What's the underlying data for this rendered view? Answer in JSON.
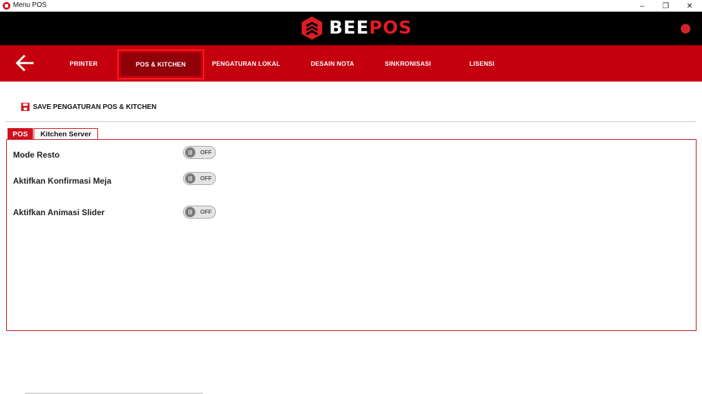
{
  "window": {
    "title": "Menu POS",
    "controls": [
      "–",
      "❐",
      "✕"
    ]
  },
  "header": {
    "brand_white": "BEE",
    "brand_red": "POS",
    "status_color": "#d0232a"
  },
  "nav": {
    "items": [
      {
        "label": "PRINTER"
      },
      {
        "label": "POS & KITCHEN"
      },
      {
        "label": "PENGATURAN LOKAL"
      },
      {
        "label": "DESAIN NOTA"
      },
      {
        "label": "SINKRONISASI"
      },
      {
        "label": "LISENSI"
      }
    ],
    "active_index": 1
  },
  "save": {
    "label": "SAVE PENGATURAN POS & KITCHEN"
  },
  "tabs": [
    {
      "label": "POS",
      "active": true
    },
    {
      "label": "Kitchen Server",
      "active": false
    }
  ],
  "settings": [
    {
      "label": "Mode Resto",
      "state": "OFF"
    },
    {
      "label": "Aktifkan Konfirmasi Meja",
      "state": "OFF"
    },
    {
      "label": "Aktifkan Animasi Slider",
      "state": "OFF"
    }
  ],
  "colors": {
    "accent_red": "#c4000f",
    "header_black": "#000000",
    "active_pill": "#8f0008"
  }
}
